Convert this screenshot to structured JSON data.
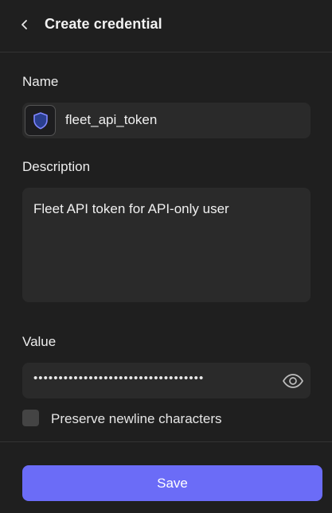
{
  "header": {
    "title": "Create credential",
    "back_icon": "chevron-left-icon"
  },
  "form": {
    "name": {
      "label": "Name",
      "value": "fleet_api_token",
      "icon": "shield-icon"
    },
    "description": {
      "label": "Description",
      "value": "Fleet API token for API-only user"
    },
    "value": {
      "label": "Value",
      "masked": "••••••••••••••••••••••••••••••••••",
      "visibility_icon": "eye-icon"
    },
    "preserve_newlines": {
      "label": "Preserve newline characters",
      "checked": false
    }
  },
  "footer": {
    "save_label": "Save"
  },
  "colors": {
    "background": "#1f1f1f",
    "field": "#2a2a2a",
    "accent": "#6b6cf7",
    "shield": "#6b6cf7"
  }
}
